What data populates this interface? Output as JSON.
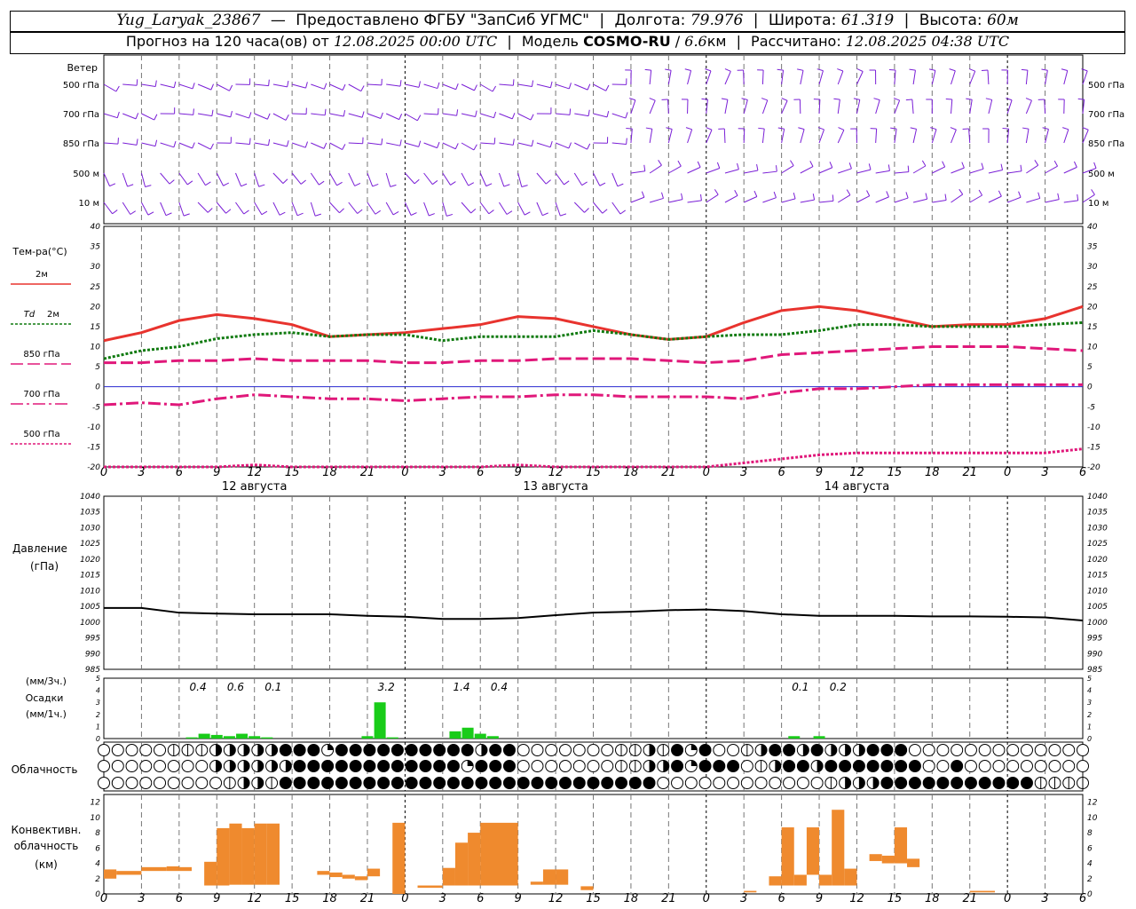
{
  "header": {
    "station": "Yug_Laryak_23867",
    "provider": "Предоставлено ФГБУ \"ЗапСиб УГМС\"",
    "lon_label": "Долгота:",
    "lon_value": "79.976",
    "lat_label": "Широта:",
    "lat_value": "61.319",
    "alt_label": "Высота:",
    "alt_value": "60м",
    "forecast_label": "Прогноз на 120 часа(ов) от",
    "forecast_start": "12.08.2025 00:00 UTC",
    "model_label": "Модель",
    "model_name": "COSMO-RU",
    "model_res_num": "6.6",
    "model_res_unit": "км",
    "calc_label": "Рассчитано:",
    "calc_time": "12.08.2025 04:38 UTC"
  },
  "time_axis": {
    "hour_labels": [
      "0",
      "3",
      "6",
      "9",
      "12",
      "15",
      "18",
      "21",
      "0",
      "3",
      "6",
      "9",
      "12",
      "15",
      "18",
      "21",
      "0",
      "3",
      "6",
      "9",
      "12",
      "15",
      "18",
      "21",
      "0",
      "3",
      "6"
    ],
    "day_labels": [
      "12 августа",
      "13 августа",
      "14 августа"
    ]
  },
  "colors": {
    "wind": "#7a1fd6",
    "t2m": "#e8332e",
    "td2m": "#0f7a0f",
    "t850": "#e0187a",
    "t700": "#e0187a",
    "t500": "#e0187a",
    "zero_line": "#2a2ad0",
    "pressure": "#000000",
    "precip": "#19cc19",
    "convective": "#ef8a2e"
  },
  "chart_data": [
    {
      "type": "wind-barbs",
      "title": "Ветер",
      "levels": [
        "500 гПа",
        "700 гПа",
        "850 гПа",
        "500 м",
        "10 м"
      ]
    },
    {
      "type": "line",
      "ylabel": "Тем-ра(°C)",
      "ylim": [
        -20,
        40
      ],
      "yticks": [
        -20,
        -15,
        -10,
        -5,
        0,
        5,
        10,
        15,
        20,
        25,
        30,
        35,
        40
      ],
      "x_hours": [
        0,
        3,
        6,
        9,
        12,
        15,
        18,
        21,
        24,
        27,
        30,
        33,
        36,
        39,
        42,
        45,
        48,
        51,
        54,
        57,
        60,
        63,
        66,
        69,
        72,
        75,
        78
      ],
      "series": [
        {
          "name": "2м",
          "legend_prefix": "",
          "style": "solid",
          "color": "#e8332e",
          "values": [
            11.5,
            13.5,
            16.5,
            18.0,
            17.0,
            15.5,
            12.5,
            13.0,
            13.5,
            14.5,
            15.5,
            17.5,
            17.0,
            15.0,
            13.0,
            11.8,
            12.5,
            16.0,
            19.0,
            20.0,
            19.0,
            17.0,
            15.0,
            15.5,
            15.5,
            17.0,
            20.0
          ]
        },
        {
          "name": "2м",
          "legend_prefix": "Td",
          "style": "dotted",
          "color": "#0f7a0f",
          "values": [
            7.0,
            9.0,
            10.0,
            12.0,
            13.0,
            13.5,
            12.5,
            13.0,
            13.0,
            11.5,
            12.5,
            12.5,
            12.5,
            14.0,
            13.0,
            11.8,
            12.5,
            13.0,
            13.0,
            14.0,
            15.5,
            15.5,
            15.0,
            15.0,
            15.0,
            15.5,
            16.0
          ]
        },
        {
          "name": "850 гПа",
          "legend_prefix": "",
          "style": "dashed",
          "color": "#e0187a",
          "values": [
            6.0,
            6.0,
            6.5,
            6.5,
            7.0,
            6.5,
            6.5,
            6.5,
            6.0,
            6.0,
            6.5,
            6.5,
            7.0,
            7.0,
            7.0,
            6.5,
            6.0,
            6.5,
            8.0,
            8.5,
            9.0,
            9.5,
            10.0,
            10.0,
            10.0,
            9.5,
            9.0
          ]
        },
        {
          "name": "700 гПа",
          "legend_prefix": "",
          "style": "dashdot",
          "color": "#e0187a",
          "values": [
            -4.5,
            -4.0,
            -4.5,
            -3.0,
            -2.0,
            -2.5,
            -3.0,
            -3.0,
            -3.5,
            -3.0,
            -2.5,
            -2.5,
            -2.0,
            -2.0,
            -2.5,
            -2.5,
            -2.5,
            -3.0,
            -1.5,
            -0.5,
            -0.5,
            0.0,
            0.5,
            0.5,
            0.5,
            0.5,
            0.5
          ]
        },
        {
          "name": "500 гПа",
          "legend_prefix": "",
          "style": "dotted",
          "color": "#e0187a",
          "values": [
            -21.0,
            -20.5,
            -20.0,
            -20.0,
            -19.5,
            -20.0,
            -20.5,
            -20.5,
            -20.0,
            -21.0,
            -20.5,
            -19.5,
            -20.0,
            -20.5,
            -21.0,
            -21.0,
            -20.5,
            -19.0,
            -18.0,
            -17.0,
            -16.5,
            -16.5,
            -16.5,
            -16.5,
            -16.5,
            -16.5,
            -15.5
          ]
        }
      ]
    },
    {
      "type": "line",
      "ylabel": "Давление",
      "ylabel_unit": "(гПа)",
      "ylim": [
        985,
        1040
      ],
      "yticks": [
        985,
        990,
        995,
        1000,
        1005,
        1010,
        1015,
        1020,
        1025,
        1030,
        1035,
        1040
      ],
      "x_hours": [
        0,
        3,
        6,
        9,
        12,
        15,
        18,
        21,
        24,
        27,
        30,
        33,
        36,
        39,
        42,
        45,
        48,
        51,
        54,
        57,
        60,
        63,
        66,
        69,
        72,
        75,
        78
      ],
      "values": [
        1004.5,
        1004.5,
        1003.0,
        1002.7,
        1002.5,
        1002.5,
        1002.5,
        1002.0,
        1001.7,
        1001.0,
        1001.0,
        1001.3,
        1002.2,
        1003.0,
        1003.3,
        1003.8,
        1004.0,
        1003.5,
        1002.5,
        1002.0,
        1002.0,
        1002.0,
        1001.8,
        1001.8,
        1001.7,
        1001.5,
        1000.5
      ]
    },
    {
      "type": "bar",
      "ylabel": "(мм/3ч.)",
      "ylabel2": "Осадки",
      "ylabel3": "(мм/1ч.)",
      "ylim": [
        0,
        5
      ],
      "yticks": [
        0,
        1,
        2,
        3,
        4,
        5
      ],
      "bars": [
        {
          "hour": 7,
          "mm": 0.1
        },
        {
          "hour": 8,
          "mm": 0.4
        },
        {
          "hour": 9,
          "mm": 0.3
        },
        {
          "hour": 10,
          "mm": 0.2
        },
        {
          "hour": 11,
          "mm": 0.4
        },
        {
          "hour": 12,
          "mm": 0.2
        },
        {
          "hour": 13,
          "mm": 0.1
        },
        {
          "hour": 21,
          "mm": 0.2
        },
        {
          "hour": 22,
          "mm": 3.0
        },
        {
          "hour": 23,
          "mm": 0.1
        },
        {
          "hour": 28,
          "mm": 0.6
        },
        {
          "hour": 29,
          "mm": 0.9
        },
        {
          "hour": 30,
          "mm": 0.4
        },
        {
          "hour": 31,
          "mm": 0.2
        },
        {
          "hour": 55,
          "mm": 0.2
        },
        {
          "hour": 57,
          "mm": 0.2
        }
      ],
      "totals": [
        {
          "hour": 7.5,
          "label": "0.4"
        },
        {
          "hour": 10.5,
          "label": "0.6"
        },
        {
          "hour": 13.5,
          "label": "0.1"
        },
        {
          "hour": 22.5,
          "label": "3.2"
        },
        {
          "hour": 28.5,
          "label": "1.4"
        },
        {
          "hour": 31.5,
          "label": "0.4"
        },
        {
          "hour": 55.5,
          "label": "0.1"
        },
        {
          "hour": 58.5,
          "label": "0.2"
        }
      ]
    },
    {
      "type": "cloud-symbols",
      "title": "Облачность",
      "rows": [
        "00000111222223334333333333323300000001121343001233232223330000000000000",
        "00000000222222333333333333433300000001122343330123323333333003000000000",
        "00000000012213333333333333333333333333330000000000001222333333333331111"
      ]
    },
    {
      "type": "bar",
      "ylabel": "Конвективн.",
      "ylabel2": "облачность",
      "ylabel3": "(км)",
      "ylim": [
        0,
        13
      ],
      "yticks": [
        0,
        2,
        4,
        6,
        8,
        10,
        12
      ],
      "bars": [
        {
          "h0": 0,
          "h1": 1,
          "base": 2,
          "top": 3.2
        },
        {
          "h0": 1,
          "h1": 3,
          "base": 2.5,
          "top": 3
        },
        {
          "h0": 3,
          "h1": 5,
          "base": 3,
          "top": 3.5
        },
        {
          "h0": 5,
          "h1": 6,
          "base": 3,
          "top": 3.6
        },
        {
          "h0": 6,
          "h1": 7,
          "base": 3,
          "top": 3.5
        },
        {
          "h0": 8,
          "h1": 9,
          "base": 1.1,
          "top": 4.2
        },
        {
          "h0": 9,
          "h1": 10,
          "base": 1.1,
          "top": 8.6
        },
        {
          "h0": 10,
          "h1": 11,
          "base": 1.2,
          "top": 9.2
        },
        {
          "h0": 11,
          "h1": 12,
          "base": 1.2,
          "top": 8.6
        },
        {
          "h0": 12,
          "h1": 13,
          "base": 1.2,
          "top": 9.2
        },
        {
          "h0": 13,
          "h1": 14,
          "base": 1.2,
          "top": 9.2
        },
        {
          "h0": 17,
          "h1": 18,
          "base": 2.5,
          "top": 3
        },
        {
          "h0": 18,
          "h1": 19,
          "base": 2.2,
          "top": 2.8
        },
        {
          "h0": 19,
          "h1": 20,
          "base": 2,
          "top": 2.5
        },
        {
          "h0": 20,
          "h1": 21,
          "base": 1.8,
          "top": 2.3
        },
        {
          "h0": 21,
          "h1": 22,
          "base": 2.3,
          "top": 3.3
        },
        {
          "h0": 23,
          "h1": 24,
          "base": 0,
          "top": 9.3
        },
        {
          "h0": 25,
          "h1": 27,
          "base": 0.8,
          "top": 1.1
        },
        {
          "h0": 27,
          "h1": 28,
          "base": 1.1,
          "top": 3.4
        },
        {
          "h0": 28,
          "h1": 29,
          "base": 1.1,
          "top": 6.7
        },
        {
          "h0": 29,
          "h1": 30,
          "base": 1.1,
          "top": 8.0
        },
        {
          "h0": 30,
          "h1": 33,
          "base": 1.1,
          "top": 9.3
        },
        {
          "h0": 34,
          "h1": 35,
          "base": 1.2,
          "top": 1.6
        },
        {
          "h0": 35,
          "h1": 36,
          "base": 1.2,
          "top": 3.2
        },
        {
          "h0": 36,
          "h1": 37,
          "base": 1.2,
          "top": 3.2
        },
        {
          "h0": 38,
          "h1": 39,
          "base": 0.5,
          "top": 1.0
        },
        {
          "h0": 51,
          "h1": 52,
          "base": 0.2,
          "top": 0.4
        },
        {
          "h0": 53,
          "h1": 54,
          "base": 1.1,
          "top": 2.3
        },
        {
          "h0": 54,
          "h1": 55,
          "base": 1.1,
          "top": 8.7
        },
        {
          "h0": 55,
          "h1": 56,
          "base": 1.1,
          "top": 2.5
        },
        {
          "h0": 56,
          "h1": 57,
          "base": 2.5,
          "top": 8.7
        },
        {
          "h0": 57,
          "h1": 58,
          "base": 1.1,
          "top": 2.5
        },
        {
          "h0": 58,
          "h1": 59,
          "base": 1.1,
          "top": 11.0
        },
        {
          "h0": 59,
          "h1": 60,
          "base": 1.1,
          "top": 3.3
        },
        {
          "h0": 61,
          "h1": 62,
          "base": 4.3,
          "top": 5.2
        },
        {
          "h0": 62,
          "h1": 63,
          "base": 4.0,
          "top": 5.0
        },
        {
          "h0": 63,
          "h1": 64,
          "base": 4.0,
          "top": 8.7
        },
        {
          "h0": 64,
          "h1": 65,
          "base": 3.5,
          "top": 4.6
        },
        {
          "h0": 69,
          "h1": 71,
          "base": 0.2,
          "top": 0.4
        }
      ]
    }
  ]
}
